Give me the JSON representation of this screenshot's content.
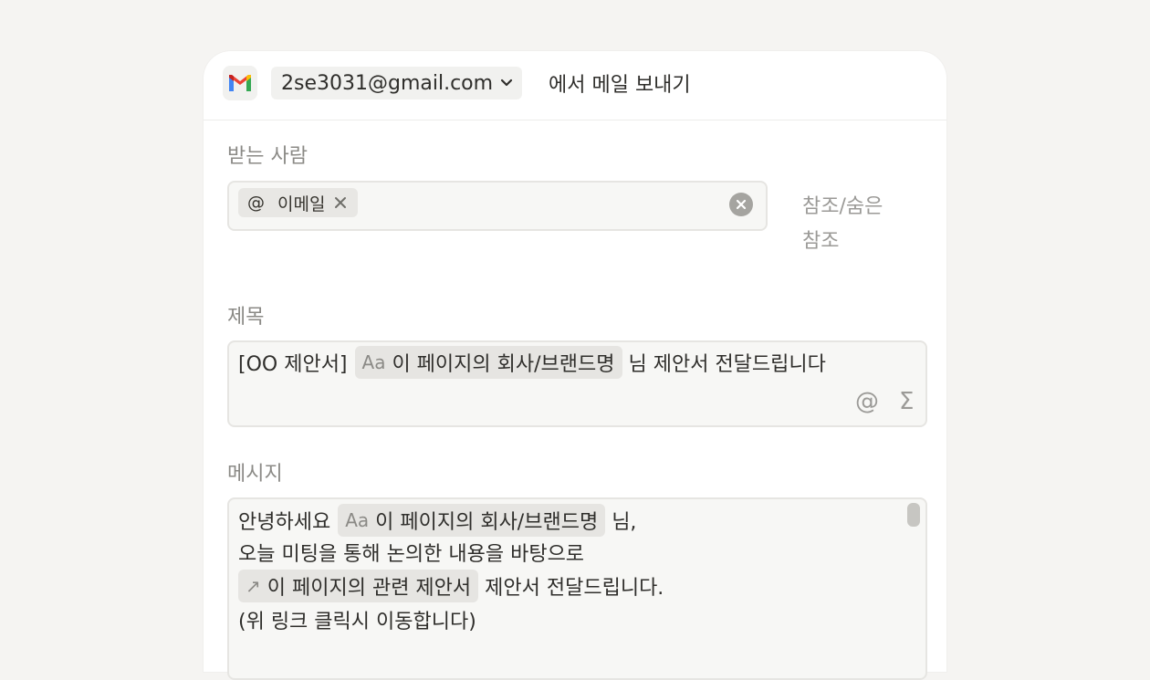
{
  "header": {
    "account": "2se3031@gmail.com",
    "suffix": "에서 메일 보내기"
  },
  "to": {
    "label": "받는 사람",
    "chip_symbol": "@",
    "chip_label": "이메일",
    "cc_link": "참조/숨은 참조"
  },
  "subject": {
    "label": "제목",
    "prefix": "[OO 제안서]",
    "token_icon": "Aa",
    "token_label": "이 페이지의 회사/브랜드명",
    "suffix": "님 제안서 전달드립니다",
    "icon_at": "@",
    "icon_sigma": "Σ"
  },
  "message": {
    "label": "메시지",
    "line1_prefix": "안녕하세요",
    "line1_token_icon": "Aa",
    "line1_token_label": "이 페이지의 회사/브랜드명",
    "line1_suffix": "님,",
    "line2": "오늘 미팅을 통해 논의한 내용을 바탕으로",
    "line3_token_icon": "↗",
    "line3_token_label": "이 페이지의 관련 제안서",
    "line3_suffix": "제안서 전달드립니다.",
    "line4": "(위 링크 클릭시 이동합니다)"
  },
  "colors": {
    "background": "#f5f4f2",
    "panel": "#ffffff",
    "field_bg": "#f7f7f5",
    "token_bg": "#e6e5e2"
  }
}
